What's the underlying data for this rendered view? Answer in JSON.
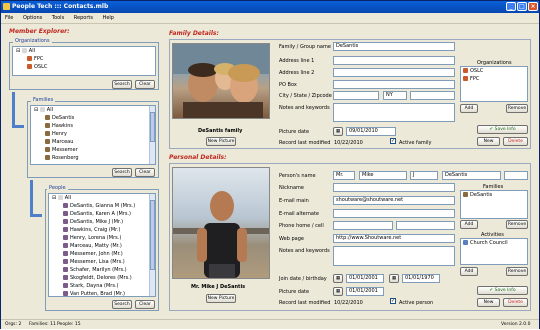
{
  "window": {
    "title": "People Tech  :::  Contacts.mlb"
  },
  "menu": [
    "File",
    "Options",
    "Tools",
    "Reports",
    "Help"
  ],
  "explorer": {
    "title": "Member Explorer:",
    "organizations": {
      "label": "Organizations",
      "items": [
        "All",
        "FPC",
        "OSLC"
      ]
    },
    "families": {
      "label": "Families",
      "items": [
        "All",
        "DeSantis",
        "Hawkins",
        "Henry",
        "Marceau",
        "Messemer",
        "Rosenberg"
      ]
    },
    "people": {
      "label": "People",
      "items": [
        "All",
        "DeSantis, Gianna M (Mrs.)",
        "DeSantis, Karen A (Mrs.)",
        "DeSantis, Mike J (Mr.)",
        "Hawkins, Craig (Mr.)",
        "Henry, Lorena (Mrs.)",
        "Marceau, Matty (Mr.)",
        "Messemer, John (Mr.)",
        "Messemer, Lisa (Mrs.)",
        "Schafer, Marilyn (Mrs.)",
        "Skogfeldt, Delores (Mrs.)",
        "Stark, Dayna (Mrs.)",
        "Van Putten, Brad (Mr.)"
      ]
    },
    "search_label": "Search",
    "clear_label": "Clear"
  },
  "family": {
    "title": "Family Details:",
    "photo_caption": "DeSantis family",
    "new_picture": "New Picture",
    "labels": {
      "name": "Family / Group name",
      "addr1": "Address line 1",
      "addr2": "Address line 2",
      "pobox": "PO Box",
      "city": "City / State / Zipcode",
      "notes": "Notes and keywords",
      "picdate": "Picture date",
      "modified": "Record last modified"
    },
    "name": "DeSantis",
    "state": "NY",
    "picture_date": "09/01/2010",
    "last_modified": "10/22/2010",
    "active_label": "Active family",
    "orgs_label": "Organizations",
    "orgs": [
      "OSLC",
      "FPC"
    ],
    "add": "Add",
    "remove": "Remove",
    "save": "Save Info",
    "new": "New",
    "delete": "Delete"
  },
  "person": {
    "title": "Personal Details:",
    "photo_caption": "Mr. Mike J DeSantis",
    "new_picture": "New Picture",
    "labels": {
      "name": "Person's name",
      "nick": "Nickname",
      "email": "E-mail main",
      "email2": "E-mail alternate",
      "phone": "Phone home / cell",
      "web": "Web page",
      "notes": "Notes and keywords",
      "dates": "Join date / birthday",
      "picdate": "Picture date",
      "modified": "Record last modified"
    },
    "prefix": "Mr.",
    "first": "Mike",
    "middle": "J",
    "last": "DeSantis",
    "email": "shoutware@shoutware.net",
    "web": "http://www.Shoutware.net",
    "join_date": "01/01/2001",
    "birthday": "01/01/1970",
    "picture_date": "01/01/2001",
    "last_modified": "10/22/2010",
    "active_label": "Active person",
    "families_label": "Families",
    "families": [
      "DeSantis"
    ],
    "activities_label": "Activities",
    "activities": [
      "Church Council"
    ],
    "add": "Add",
    "remove": "Remove",
    "save": "Save Info",
    "new": "New",
    "delete": "Delete"
  },
  "status": {
    "orgs": "Orgs: 2",
    "families": "Families: 11",
    "people": "People: 15",
    "version": "Version 2.0.0"
  },
  "colors": {
    "accent": "#c0261e",
    "title_bar": "#0a5fd8",
    "window_bg": "#ece9d8"
  }
}
